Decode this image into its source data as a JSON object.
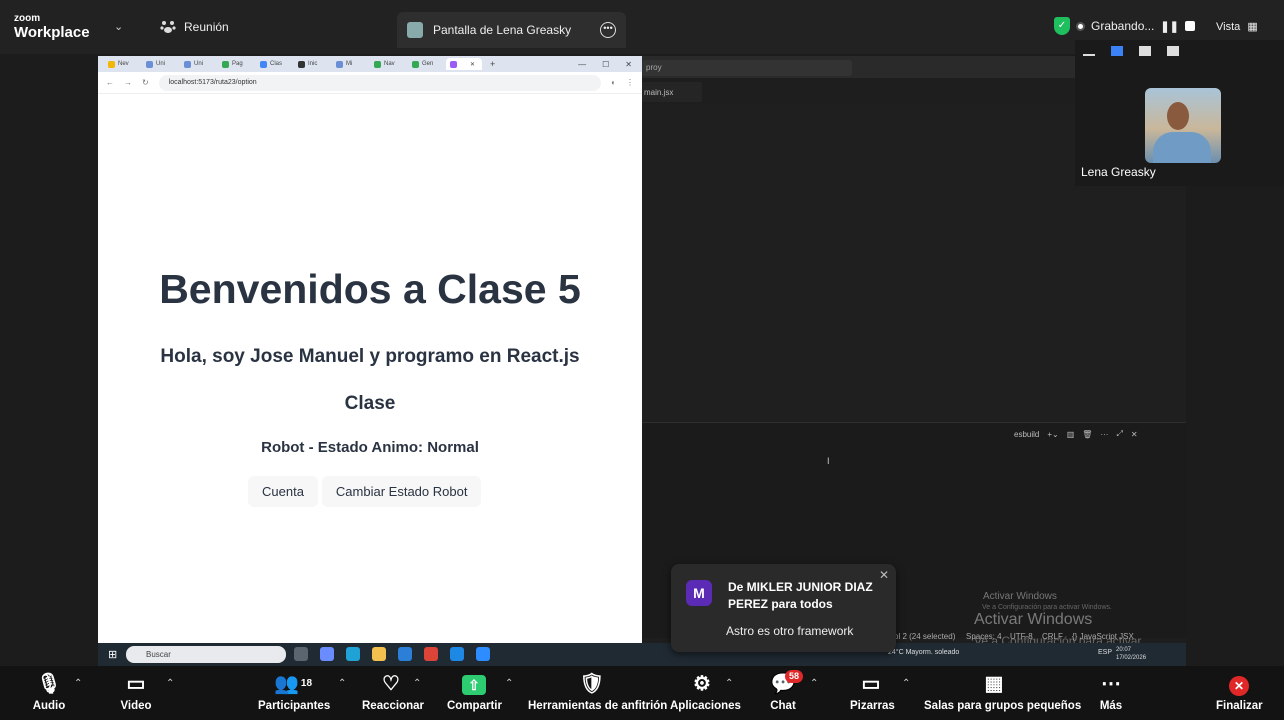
{
  "topbar": {
    "logo_small": "zoom",
    "logo_big": "Workplace",
    "meeting_label": "Reunión",
    "share_tab_label": "Pantalla de Lena Greasky",
    "recording_label": "Grabando...",
    "view_label": "Vista"
  },
  "browser": {
    "tabs": [
      "Nev",
      "Uni",
      "Uni",
      "Pag",
      "Clas",
      "Inic",
      "Mi",
      "Nav",
      "Gen",
      ""
    ],
    "url": "localhost:5173/ruta23/option",
    "content": {
      "title": "Benvenidos a Clase 5",
      "subtitle": "Hola, soy Jose Manuel y programo en React.js",
      "section": "Clase",
      "robot_state": "Robot - Estado Animo: Normal",
      "button_count": "Cuenta",
      "button_change": "Cambiar Estado Robot"
    }
  },
  "vscode": {
    "search": "proy",
    "tab": "main.jsx",
    "panel_label": "esbuild",
    "status_items": [
      "ol 2 (24 selected)",
      "Spaces: 4",
      "UTF-8",
      "CRLF",
      "{} JavaScript JSX"
    ],
    "activate_title": "Activar Windows",
    "activate_sub": "Ve a Configuración para activar Windows.",
    "activate_title_big": "Activar Windows",
    "activate_sub_big": "Ve a Configuración para activar Windows."
  },
  "taskbar": {
    "search_placeholder": "Buscar",
    "weather": "24°C  Mayorm. soleado",
    "lang": "ESP",
    "time": "20:07",
    "date": "17/02/2026"
  },
  "participant": {
    "name": "Lena Greasky"
  },
  "toast": {
    "avatar_letter": "M",
    "from": "De MIKLER JUNIOR DIAZ PEREZ para todos",
    "message": "Astro es otro framework"
  },
  "toolbar": {
    "audio": "Audio",
    "video": "Video",
    "participants": "Participantes",
    "participants_count": "18",
    "react": "Reaccionar",
    "share": "Compartir",
    "host_tools": "Herramientas de anfitrión",
    "apps": "Aplicaciones",
    "chat": "Chat",
    "chat_badge": "58",
    "whiteboards": "Pizarras",
    "breakout": "Salas para grupos pequeños",
    "more": "Más",
    "end": "Finalizar"
  },
  "colors": {
    "accent_green": "#1fbf5f",
    "badge_red": "#e02828",
    "toast_avatar": "#5b2bb5",
    "share_green": "#2ecc71"
  }
}
